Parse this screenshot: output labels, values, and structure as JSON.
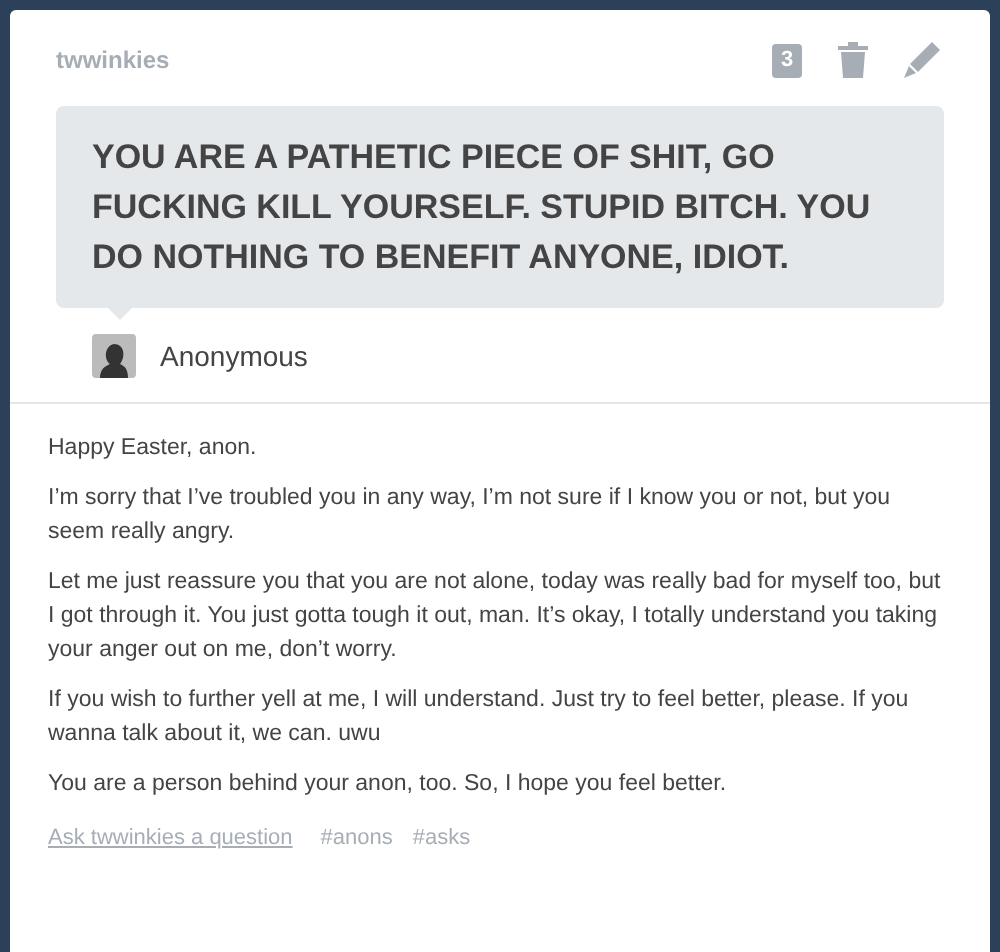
{
  "post": {
    "blog_name": "twwinkies",
    "note_count": "3",
    "question": "YOU ARE A PATHETIC PIECE OF SHIT, GO FUCKING KILL YOURSELF. STUPID BITCH. YOU DO NOTHING TO BENEFIT ANYONE, IDIOT.",
    "asker": "Anonymous",
    "answer": [
      "Happy Easter, anon.",
      "I’m sorry that I’ve troubled you in any way, I’m not sure if I know you or not, but you seem really angry.",
      "Let me just reassure you that you are not alone, today was really bad for myself too, but I got through it. You just gotta tough it out, man. It’s okay, I totally understand you taking your anger out on me, don’t worry.",
      "If you wish to further yell at me, I will understand. Just try to feel better, please. If you wanna talk about it, we can. uwu",
      "You are a person behind your anon, too. So, I hope you feel better."
    ],
    "ask_link": "Ask twwinkies a question",
    "tags": [
      "#anons",
      "#asks"
    ]
  }
}
